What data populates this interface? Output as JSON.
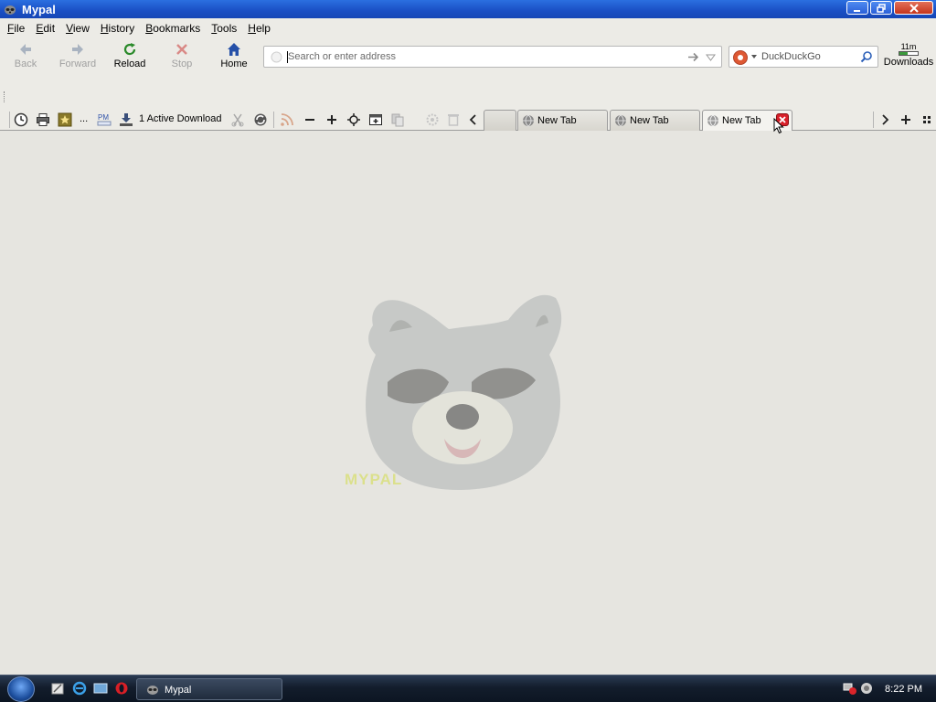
{
  "window": {
    "title": "Mypal"
  },
  "menu": {
    "items": [
      {
        "key": "F",
        "rest": "ile"
      },
      {
        "key": "E",
        "rest": "dit"
      },
      {
        "key": "V",
        "rest": "iew"
      },
      {
        "key": "H",
        "rest": "istory"
      },
      {
        "key": "B",
        "rest": "ookmarks"
      },
      {
        "key": "T",
        "rest": "ools"
      },
      {
        "key": "H",
        "rest": "elp"
      }
    ]
  },
  "nav": {
    "back_label": "Back",
    "forward_label": "Forward",
    "reload_label": "Reload",
    "stop_label": "Stop",
    "home_label": "Home",
    "url_placeholder": "Search or enter address",
    "search_engine": "DuckDuckGo",
    "downloads_count": "11m",
    "downloads_label": "Downloads"
  },
  "tabbar": {
    "more_label": "...",
    "active_download_label": "1 Active Download",
    "tabs": [
      {
        "label": ""
      },
      {
        "label": "New Tab"
      },
      {
        "label": "New Tab"
      },
      {
        "label": "New Tab"
      }
    ]
  },
  "content": {
    "logo_text": "MYPAL"
  },
  "taskbar": {
    "task_label": "Mypal",
    "clock": "8:22 PM"
  },
  "colors": {
    "titlebar": "#1a4fc4",
    "accent_reload": "#2a8a2a",
    "accent_stop": "#c0392b",
    "tab_close": "#d8202a"
  }
}
